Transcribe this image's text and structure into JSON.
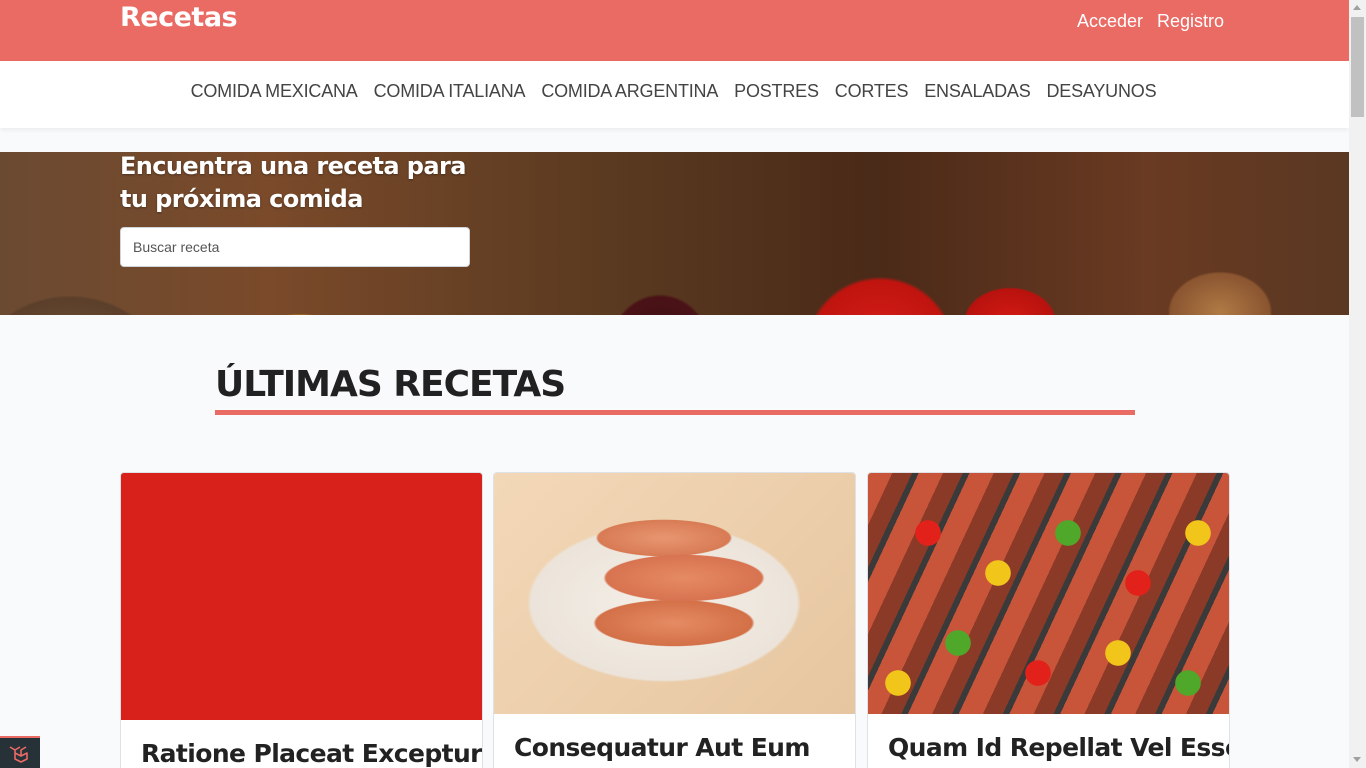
{
  "header": {
    "brand": "Recetas",
    "login_label": "Acceder",
    "register_label": "Registro"
  },
  "categories": [
    "COMIDA MEXICANA",
    "COMIDA ITALIANA",
    "COMIDA ARGENTINA",
    "POSTRES",
    "CORTES",
    "ENSALADAS",
    "DESAYUNOS"
  ],
  "hero": {
    "title": "Encuentra una receta para tu próxima comida",
    "search_placeholder": "Buscar receta"
  },
  "latest": {
    "title": "ÚLTIMAS RECETAS",
    "recipes": [
      {
        "title": "Ratione Placeat Excepturi"
      },
      {
        "title": "Consequatur Aut Eum"
      },
      {
        "title": "Quam Id Repellat Vel Esse Et"
      }
    ]
  },
  "colors": {
    "accent": "#ea6a64",
    "background": "#f8fafc"
  },
  "icons": {
    "debugbar": "laravel-icon"
  }
}
